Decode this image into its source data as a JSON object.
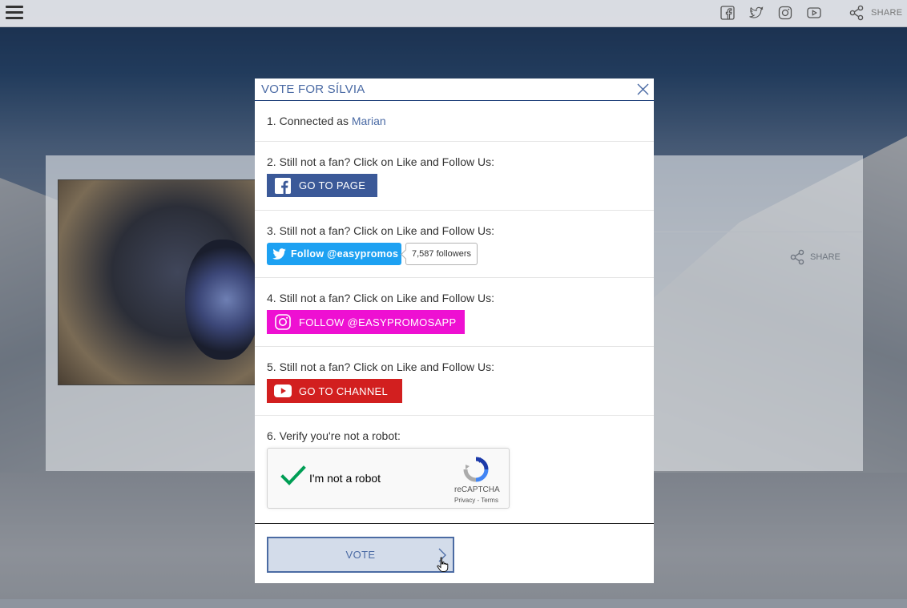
{
  "topbar": {
    "share_label": "SHARE",
    "social_icons": [
      "facebook-icon",
      "twitter-icon",
      "instagram-icon",
      "youtube-icon"
    ]
  },
  "card": {
    "share_label": "SHARE"
  },
  "modal": {
    "title": "VOTE FOR SÍLVIA",
    "step1": {
      "prefix": "1. Connected as ",
      "username": "Marian"
    },
    "step2": {
      "text": "2. Still not a fan? Click on Like and Follow Us:",
      "button_label": "GO TO PAGE"
    },
    "step3": {
      "text": "3. Still not a fan? Click on Like and Follow Us:",
      "button_label": "Follow @easypromos",
      "followers": "7,587 followers"
    },
    "step4": {
      "text": "4. Still not a fan? Click on Like and Follow Us:",
      "button_label": "FOLLOW @EASYPROMOSAPP"
    },
    "step5": {
      "text": "5. Still not a fan? Click on Like and Follow Us:",
      "button_label": "GO TO CHANNEL"
    },
    "step6": {
      "text": "6. Verify you're not a robot:",
      "captcha_label": "I'm not a robot",
      "captcha_brand": "reCAPTCHA",
      "captcha_links": "Privacy - Terms"
    },
    "vote_label": "VOTE"
  },
  "colors": {
    "facebook": "#3b5998",
    "twitter": "#1da1f2",
    "instagram": "#ee10d2",
    "youtube": "#d21f1f",
    "accent": "#4a6aa4",
    "captcha_check": "#009e55"
  }
}
